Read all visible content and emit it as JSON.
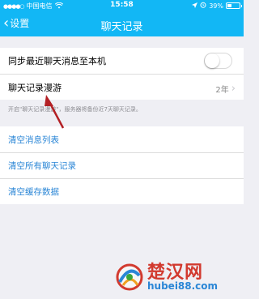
{
  "status_bar": {
    "carrier": "中国电信",
    "time": "15:58",
    "battery": "39%",
    "battery_level": 0.39
  },
  "nav": {
    "back_label": "设置",
    "title": "聊天记录"
  },
  "sync_section": {
    "sync_label": "同步最近聊天消息至本机",
    "sync_enabled": false,
    "roaming_label": "聊天记录漫游",
    "roaming_value": "2年",
    "footnote": "开启\"聊天记录漫游\"，服务器将备份近7天聊天记录。"
  },
  "clear_section": {
    "items": [
      {
        "label": "清空消息列表"
      },
      {
        "label": "清空所有聊天记录"
      },
      {
        "label": "清空缓存数据"
      }
    ]
  },
  "watermark": {
    "brand": "楚汉网",
    "domain": "hubei88.com"
  },
  "colors": {
    "accent": "#12b7f5",
    "link": "#2a86d6",
    "arrow": "#b32025",
    "watermark_red": "#d23a2f"
  }
}
